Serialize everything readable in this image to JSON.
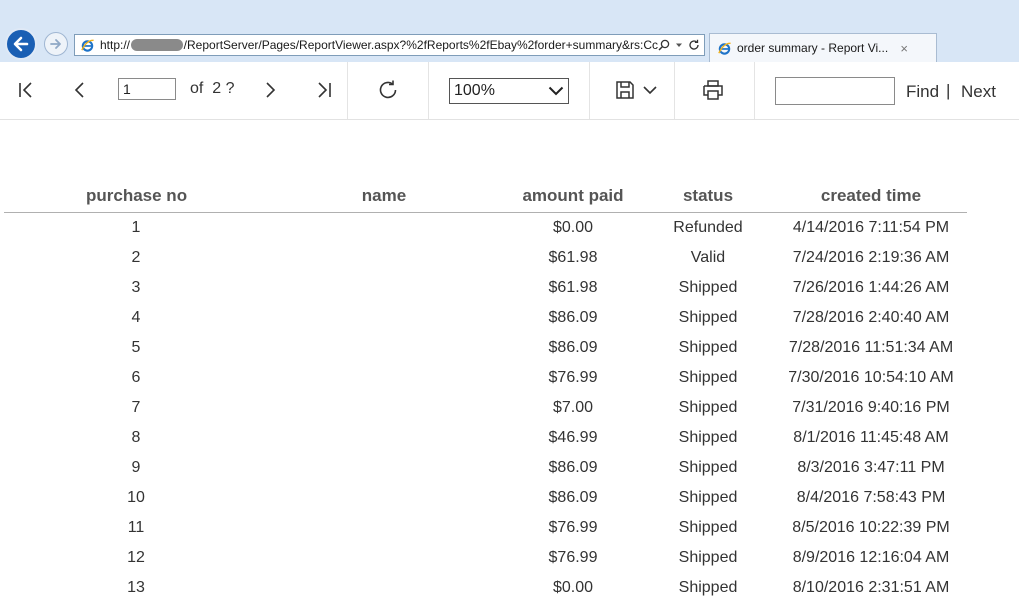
{
  "browser": {
    "address_prefix": "http://",
    "address_rest": "/ReportServer/Pages/ReportViewer.aspx?%2fReports%2fEbay%2forder+summary&rs:Cc",
    "tab_title": "order summary - Report Vi...",
    "tab_close": "×"
  },
  "toolbar": {
    "page_value": "1",
    "of_label": "of",
    "page_total": "2 ?",
    "zoom": "100%",
    "find_label": "Find",
    "find_separator": "|",
    "next_label": "Next"
  },
  "report": {
    "columns": [
      "purchase no",
      "name",
      "amount paid",
      "status",
      "created time"
    ],
    "rows": [
      {
        "no": "1",
        "name": "",
        "amount": "$0.00",
        "status": "Refunded",
        "created": "4/14/2016 7:11:54 PM"
      },
      {
        "no": "2",
        "name": "",
        "amount": "$61.98",
        "status": "Valid",
        "created": "7/24/2016 2:19:36 AM"
      },
      {
        "no": "3",
        "name": "",
        "amount": "$61.98",
        "status": "Shipped",
        "created": "7/26/2016 1:44:26 AM"
      },
      {
        "no": "4",
        "name": "",
        "amount": "$86.09",
        "status": "Shipped",
        "created": "7/28/2016 2:40:40 AM"
      },
      {
        "no": "5",
        "name": "",
        "amount": "$86.09",
        "status": "Shipped",
        "created": "7/28/2016 11:51:34 AM"
      },
      {
        "no": "6",
        "name": "",
        "amount": "$76.99",
        "status": "Shipped",
        "created": "7/30/2016 10:54:10 AM"
      },
      {
        "no": "7",
        "name": "",
        "amount": "$7.00",
        "status": "Shipped",
        "created": "7/31/2016 9:40:16 PM"
      },
      {
        "no": "8",
        "name": "",
        "amount": "$46.99",
        "status": "Shipped",
        "created": "8/1/2016 11:45:48 AM"
      },
      {
        "no": "9",
        "name": "",
        "amount": "$86.09",
        "status": "Shipped",
        "created": "8/3/2016 3:47:11 PM"
      },
      {
        "no": "10",
        "name": "",
        "amount": "$86.09",
        "status": "Shipped",
        "created": "8/4/2016 7:58:43 PM"
      },
      {
        "no": "11",
        "name": "",
        "amount": "$76.99",
        "status": "Shipped",
        "created": "8/5/2016 10:22:39 PM"
      },
      {
        "no": "12",
        "name": "",
        "amount": "$76.99",
        "status": "Shipped",
        "created": "8/9/2016 12:16:04 AM"
      },
      {
        "no": "13",
        "name": "",
        "amount": "$0.00",
        "status": "Shipped",
        "created": "8/10/2016 2:31:51 AM"
      }
    ]
  },
  "colors": {
    "chrome_bg": "#d8e6f6",
    "back_button": "#1a5fb4",
    "header_text": "#555555",
    "row_text": "#333333"
  },
  "icons": [
    "back-arrow-icon",
    "forward-arrow-icon",
    "ie-icon",
    "search-icon",
    "refresh-icon",
    "first-page-icon",
    "previous-page-icon",
    "next-page-icon",
    "last-page-icon",
    "toolbar-refresh-icon",
    "chevron-down-icon",
    "save-icon",
    "print-icon"
  ]
}
